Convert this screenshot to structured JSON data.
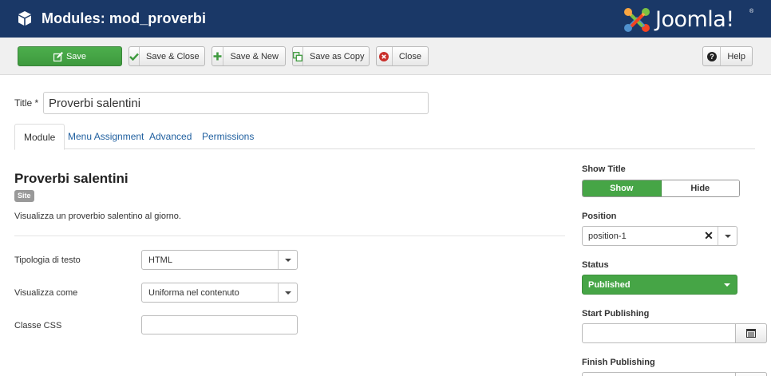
{
  "header": {
    "title": "Modules: mod_proverbi",
    "logo_text": "Joomla!",
    "logo_registered": "®"
  },
  "toolbar": {
    "save": "Save",
    "save_close": "Save & Close",
    "save_new": "Save & New",
    "save_copy": "Save as Copy",
    "close": "Close",
    "help": "Help"
  },
  "form": {
    "title_label": "Title *",
    "title_value": "Proverbi salentini"
  },
  "tabs": [
    "Module",
    "Menu Assignment",
    "Advanced",
    "Permissions"
  ],
  "module": {
    "name": "Proverbi salentini",
    "badge": "Site",
    "description": "Visualizza un proverbio salentino al giorno.",
    "fields": {
      "tipologia_label": "Tipologia di testo",
      "tipologia_value": "HTML",
      "visualizza_label": "Visualizza come",
      "visualizza_value": "Uniforma nel contenuto",
      "classe_label": "Classe CSS",
      "classe_value": ""
    }
  },
  "sidebar": {
    "show_title_label": "Show Title",
    "show_label": "Show",
    "hide_label": "Hide",
    "position_label": "Position",
    "position_value": "position-1",
    "status_label": "Status",
    "status_value": "Published",
    "start_label": "Start Publishing",
    "finish_label": "Finish Publishing"
  },
  "colors": {
    "header_bg": "#1a3867",
    "success": "#46a546",
    "link": "#1f5f9f"
  },
  "icons": [
    "cube-icon",
    "joomla-logo",
    "pencil-square-icon",
    "check-icon",
    "plus-icon",
    "copy-icon",
    "times-circle-icon",
    "question-circle-icon",
    "calendar-icon"
  ]
}
